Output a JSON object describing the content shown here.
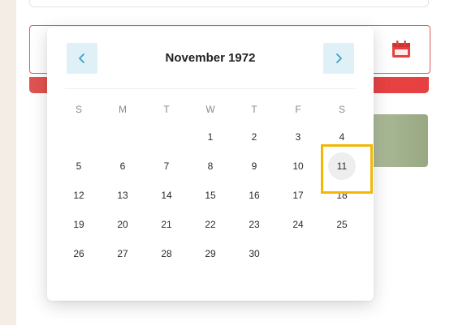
{
  "calendar": {
    "title": "November 1972",
    "weekdays": [
      "S",
      "M",
      "T",
      "W",
      "T",
      "F",
      "S"
    ],
    "weeks": [
      [
        "",
        "",
        "",
        "1",
        "2",
        "3",
        "4"
      ],
      [
        "5",
        "6",
        "7",
        "8",
        "9",
        "10",
        "11"
      ],
      [
        "12",
        "13",
        "14",
        "15",
        "16",
        "17",
        "18"
      ],
      [
        "19",
        "20",
        "21",
        "22",
        "23",
        "24",
        "25"
      ],
      [
        "26",
        "27",
        "28",
        "29",
        "30",
        "",
        ""
      ]
    ],
    "selected_day": "11",
    "prev_icon": "chevron-left-icon",
    "next_icon": "chevron-right-icon"
  },
  "colors": {
    "nav_bg": "#dff1f7",
    "nav_arrow": "#3aa0c8",
    "accent_red": "#e74040",
    "highlight": "#f2b705"
  },
  "icons": {
    "calendar": "calendar-icon"
  }
}
